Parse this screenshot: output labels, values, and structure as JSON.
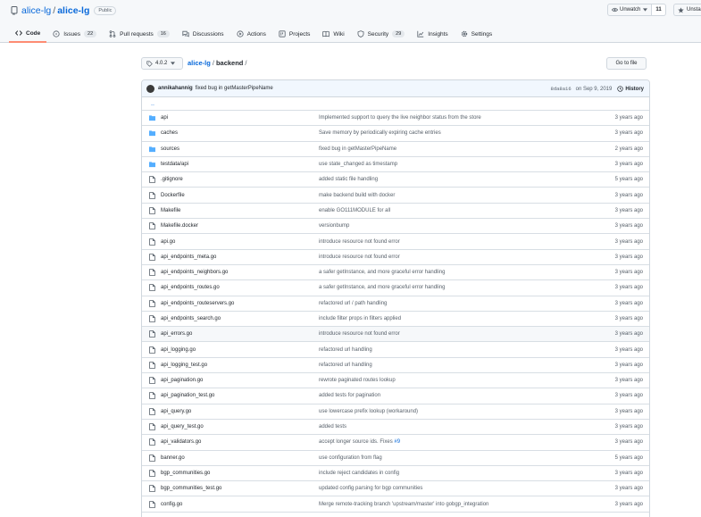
{
  "repo": {
    "owner": "alice-lg",
    "separator": "/",
    "name": "alice-lg",
    "visibility": "Public",
    "watch_label": "Unwatch",
    "watch_count": "11",
    "star_label": "Unsta"
  },
  "tabs": [
    {
      "label": "Code",
      "icon": "code-icon",
      "active": true,
      "counter": null
    },
    {
      "label": "Issues",
      "icon": "issue-icon",
      "counter": "22"
    },
    {
      "label": "Pull requests",
      "icon": "pull-request-icon",
      "counter": "16"
    },
    {
      "label": "Discussions",
      "icon": "discussion-icon",
      "counter": null
    },
    {
      "label": "Actions",
      "icon": "play-icon",
      "counter": null
    },
    {
      "label": "Projects",
      "icon": "project-icon",
      "counter": null
    },
    {
      "label": "Wiki",
      "icon": "book-icon",
      "counter": null
    },
    {
      "label": "Security",
      "icon": "shield-icon",
      "counter": "29"
    },
    {
      "label": "Insights",
      "icon": "graph-icon",
      "counter": null
    },
    {
      "label": "Settings",
      "icon": "gear-icon",
      "counter": null
    }
  ],
  "branch": {
    "label": "4.0.2"
  },
  "breadcrumb": {
    "repo": "alice-lg",
    "sep": "/",
    "dir": "backend",
    "trailing": "/"
  },
  "goto_file_label": "Go to file",
  "latest_commit": {
    "author": "annikahannig",
    "message": "fixed bug in getMasterPipeName",
    "sha": "8da8a16",
    "date": "on Sep 9, 2019",
    "history_label": "History"
  },
  "parent_dir": "..",
  "files": [
    {
      "type": "dir",
      "name": "api",
      "message": "Implemented support to query the live neighbor status from the store",
      "age": "3 years ago"
    },
    {
      "type": "dir",
      "name": "caches",
      "message": "Save memory by periodically expiring cache entries",
      "age": "3 years ago"
    },
    {
      "type": "dir",
      "name": "sources",
      "message": "fixed bug in getMasterPipeName",
      "age": "2 years ago"
    },
    {
      "type": "dir",
      "name": "testdata/api",
      "message": "use state_changed as timestamp",
      "age": "3 years ago"
    },
    {
      "type": "file",
      "name": ".gitignore",
      "message": "added static file handling",
      "age": "5 years ago"
    },
    {
      "type": "file",
      "name": "Dockerfile",
      "message": "make backend build with docker",
      "age": "3 years ago"
    },
    {
      "type": "file",
      "name": "Makefile",
      "message": "enable GO111MODULE for all",
      "age": "3 years ago"
    },
    {
      "type": "file",
      "name": "Makefile.docker",
      "message": "versionbump",
      "age": "3 years ago"
    },
    {
      "type": "file",
      "name": "api.go",
      "message": "introduce resource not found error",
      "age": "3 years ago"
    },
    {
      "type": "file",
      "name": "api_endpoints_meta.go",
      "message": "introduce resource not found error",
      "age": "3 years ago"
    },
    {
      "type": "file",
      "name": "api_endpoints_neighbors.go",
      "message": "a safer getInstance, and more graceful error handling",
      "age": "3 years ago"
    },
    {
      "type": "file",
      "name": "api_endpoints_routes.go",
      "message": "a safer getInstance, and more graceful error handling",
      "age": "3 years ago"
    },
    {
      "type": "file",
      "name": "api_endpoints_routeservers.go",
      "message": "refactored url / path handling",
      "age": "3 years ago"
    },
    {
      "type": "file",
      "name": "api_endpoints_search.go",
      "message": "include filter props in filters applied",
      "age": "3 years ago"
    },
    {
      "type": "file",
      "name": "api_errors.go",
      "message": "introduce resource not found error",
      "age": "3 years ago",
      "hover": true
    },
    {
      "type": "file",
      "name": "api_logging.go",
      "message": "refactored url handling",
      "age": "3 years ago"
    },
    {
      "type": "file",
      "name": "api_logging_test.go",
      "message": "refactored url handling",
      "age": "3 years ago"
    },
    {
      "type": "file",
      "name": "api_pagination.go",
      "message": "rewrote paginated routes lookup",
      "age": "3 years ago"
    },
    {
      "type": "file",
      "name": "api_pagination_test.go",
      "message": "added tests for pagination",
      "age": "3 years ago"
    },
    {
      "type": "file",
      "name": "api_query.go",
      "message": "use lowercase prefix lookup (workaround)",
      "age": "3 years ago"
    },
    {
      "type": "file",
      "name": "api_query_test.go",
      "message": "added tests",
      "age": "3 years ago"
    },
    {
      "type": "file",
      "name": "api_validators.go",
      "message": "accept longer source ids. Fixes ",
      "link": "#9",
      "age": "3 years ago"
    },
    {
      "type": "file",
      "name": "banner.go",
      "message": "use configuration from flag",
      "age": "5 years ago"
    },
    {
      "type": "file",
      "name": "bgp_communities.go",
      "message": "include reject candidates in config",
      "age": "3 years ago"
    },
    {
      "type": "file",
      "name": "bgp_communities_test.go",
      "message": "updated config parsing for bgp communities",
      "age": "3 years ago"
    },
    {
      "type": "file",
      "name": "config.go",
      "message": "Merge remote-tracking branch 'upstream/master' into gobgp_integration",
      "age": "3 years ago"
    }
  ],
  "colors": {
    "link": "#0969da",
    "folder": "#54aeff",
    "tab_underline": "#fd8c73",
    "border": "#d0d7de"
  }
}
